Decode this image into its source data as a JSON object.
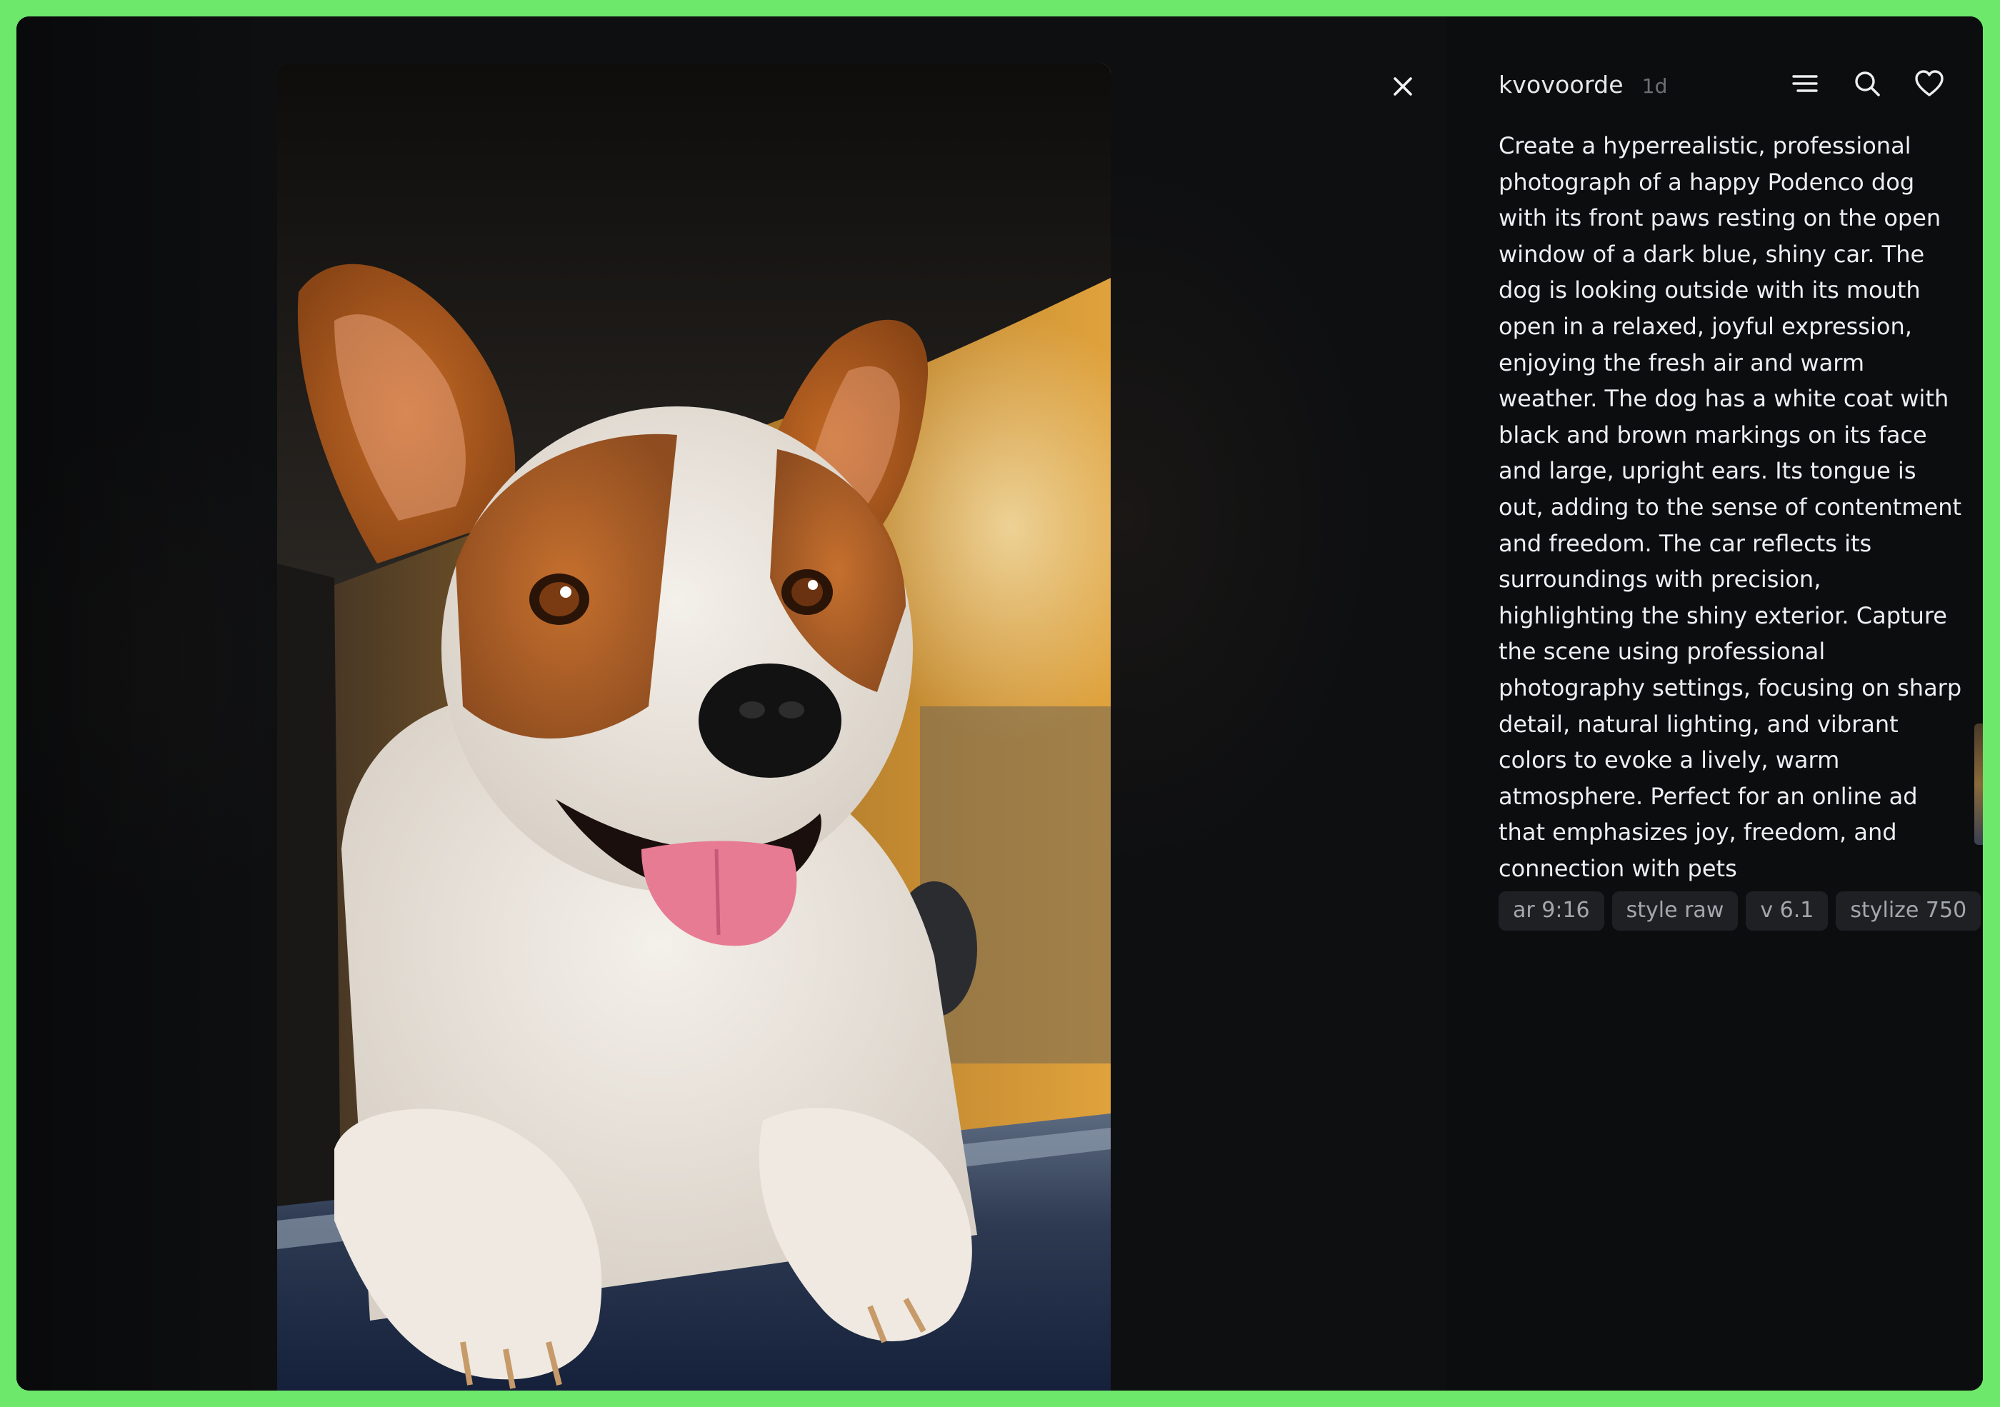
{
  "post": {
    "username": "kvovoorde",
    "age": "1d",
    "prompt": "Create a hyperrealistic, professional photograph of a happy Podenco dog with its front paws resting on the open window of a dark blue, shiny car. The dog is looking outside with its mouth open in a relaxed, joyful expression, enjoying the fresh air and warm weather. The dog has a white coat with black and brown markings on its face and large, upright ears. Its tongue is out, adding to the sense of contentment and freedom. The car reflects its surroundings with precision, highlighting the shiny exterior. Capture the scene using professional photography settings, focusing on sharp detail, natural lighting, and vibrant colors to evoke a lively, warm atmosphere. Perfect for an online ad that emphasizes joy, freedom, and connection with pets",
    "params": [
      "ar 9:16",
      "style raw",
      "v 6.1",
      "stylize 750"
    ]
  },
  "icons": {
    "close": "close-icon",
    "menu": "menu-icon",
    "search": "search-icon",
    "like": "heart-icon"
  },
  "colors": {
    "frame": "#6ee86a",
    "background": "#0d0e10",
    "text": "#eceef1",
    "muted": "#6c6f76",
    "chip_bg": "#1e2024",
    "chip_text": "#a3a7ae"
  }
}
